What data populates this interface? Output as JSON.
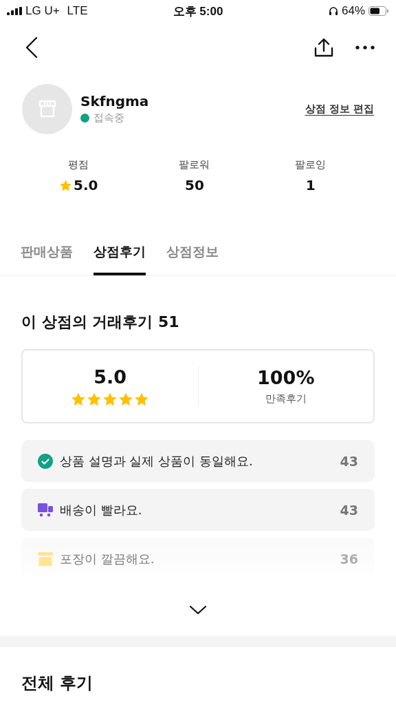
{
  "status_bar": {
    "carrier": "LG U+",
    "network": "LTE",
    "time": "오후 5:00",
    "battery": "64%"
  },
  "store": {
    "name": "Skfngma",
    "status": "접속중",
    "online": true,
    "edit_link": "상점 정보 편집"
  },
  "stats": [
    {
      "label": "평점",
      "value": "5.0",
      "kind": "rating"
    },
    {
      "label": "팔로워",
      "value": "50",
      "kind": "count"
    },
    {
      "label": "팔로잉",
      "value": "1",
      "kind": "count"
    }
  ],
  "tabs": [
    {
      "label": "판매상품",
      "selected": false
    },
    {
      "label": "상점후기",
      "selected": true
    },
    {
      "label": "상점정보",
      "selected": false
    }
  ],
  "reviews": {
    "title": "이 상점의 거래후기 51",
    "score": "5.0",
    "stars": 5,
    "satisfaction": "100%",
    "satisfaction_label": "만족후기",
    "items": [
      {
        "kind": "check",
        "text": "상품 설명과 실제 상품이 동일해요.",
        "count": "43",
        "faded": false
      },
      {
        "kind": "truck",
        "text": "배송이 빨라요.",
        "count": "43",
        "faded": false
      },
      {
        "kind": "box",
        "text": "포장이 깔끔해요.",
        "count": "36",
        "faded": true
      }
    ]
  },
  "all_reviews_title": "전체 후기"
}
